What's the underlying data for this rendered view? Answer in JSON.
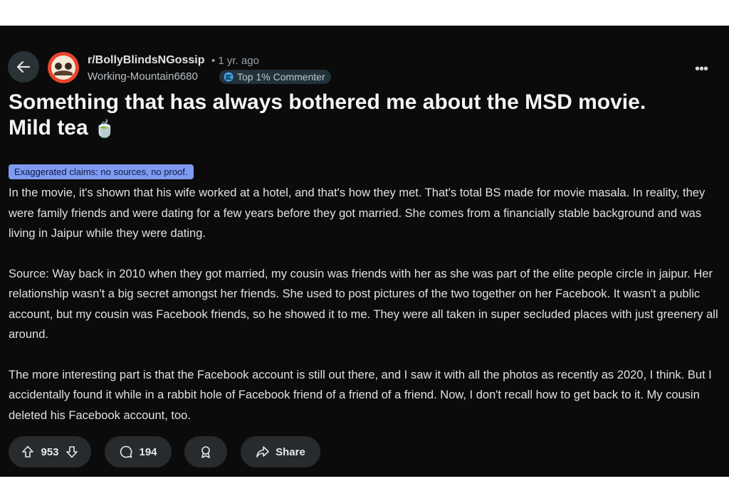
{
  "post": {
    "subreddit": "r/BollyBlindsNGossip",
    "time": "• 1 yr. ago",
    "author": "Working-Mountain6680",
    "author_flair": "Top 1% Commenter",
    "title_line1": "Something that has always bothered me about the MSD movie.",
    "title_line2": "Mild tea",
    "title_emoji": "🍵",
    "flair": "Exaggerated claims: no sources, no proof.",
    "paragraphs": [
      "In the movie, it's shown that his wife worked at a hotel, and that's how they met. That's total BS made for movie masala. In reality, they were family friends and were dating for a few years before they got married. She comes from a financially stable background and was living in Jaipur while they were dating.",
      "Source: Way back in 2010 when they got married, my cousin was friends with her as she was part of the elite people circle in jaipur. Her relationship wasn't a big secret amongst her friends. She used to post pictures of the two together on her Facebook. It wasn't a public account, but my cousin was Facebook friends, so he showed it to me. They were all taken in super secluded places with just greenery all around.",
      "The more interesting part is that the Facebook account is still out there, and I saw it with all the photos as recently as 2020, I think. But I accidentally found it while in a rabbit hole of Facebook friend of a friend of a friend. Now, I don't recall how to get back to it. My cousin deleted his Facebook account, too."
    ]
  },
  "actions": {
    "votes": "953",
    "comments": "194",
    "share_label": "Share"
  },
  "more_label": "•••",
  "colors": {
    "background": "#0b0b0b",
    "flair_bg": "#7f9bf1",
    "avatar_bg": "#e8452a",
    "button_bg": "#272b2e"
  },
  "icons": [
    "back-arrow-icon",
    "subreddit-avatar-icon",
    "top-commenter-icon",
    "more-options-icon",
    "upvote-icon",
    "downvote-icon",
    "comment-icon",
    "award-icon",
    "share-icon"
  ]
}
